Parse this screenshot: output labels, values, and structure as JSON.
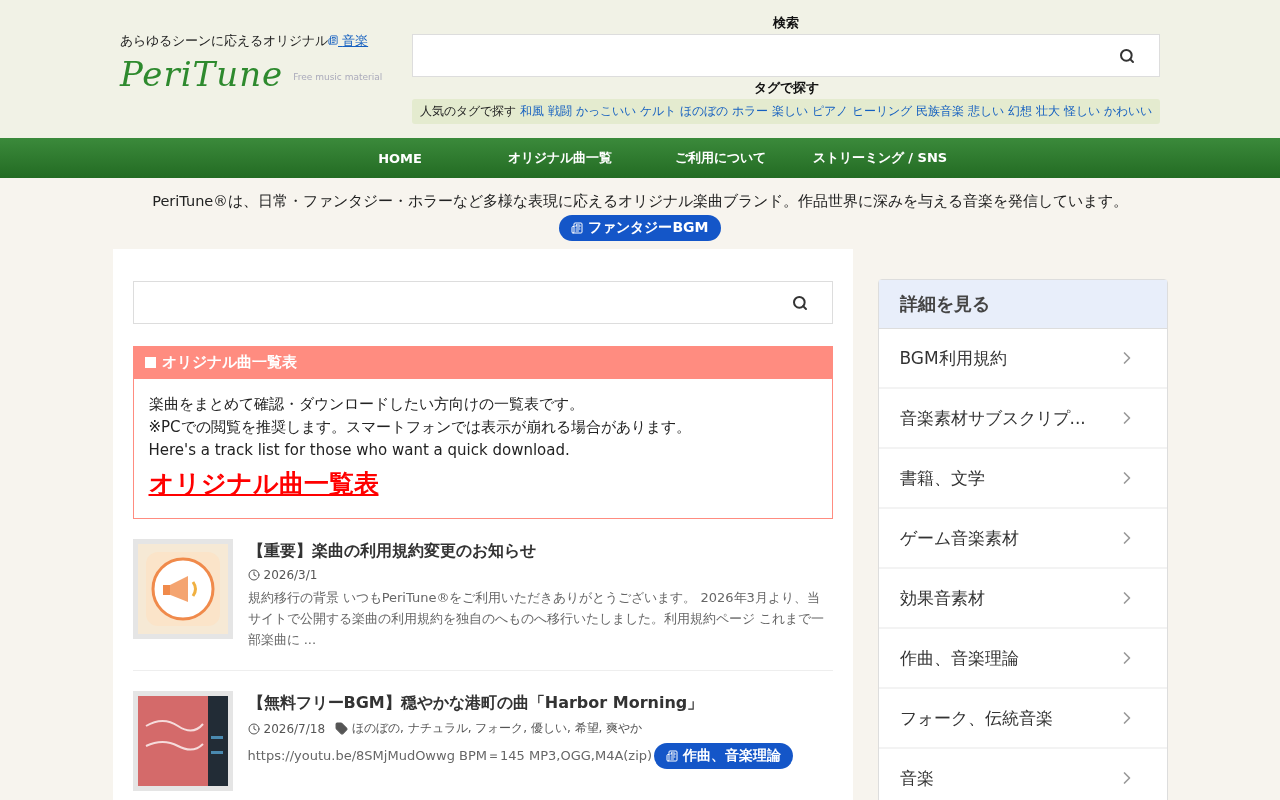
{
  "header": {
    "tagline": "あらゆるシーンに応えるオリジナル",
    "tagline_link": "音楽",
    "logo": "PeriTune",
    "logo_sub": "Free music material",
    "search_label": "検索",
    "tag_label": "タグで探す",
    "tag_intro": "人気のタグで探す",
    "tags": [
      "和風",
      "戦闘",
      "かっこいい",
      "ケルト",
      "ほのぼの",
      "ホラー",
      "楽しい",
      "ピアノ",
      "ヒーリング",
      "民族音楽",
      "悲しい",
      "幻想",
      "壮大",
      "怪しい",
      "かわいい"
    ]
  },
  "nav": [
    {
      "label": "HOME"
    },
    {
      "label": "オリジナル曲一覧"
    },
    {
      "label": "ご利用について"
    },
    {
      "label": "ストリーミング / SNS"
    }
  ],
  "intro": {
    "text": "PeriTune®は、日常・ファンタジー・ホラーなど多様な表現に応えるオリジナル楽曲ブランド。作品世界に深みを与える音楽を発信しています。",
    "badge": "ファンタジーBGM"
  },
  "notice": {
    "title": "オリジナル曲一覧表",
    "lines": [
      "楽曲をまとめて確認・ダウンロードしたい方向けの一覧表です。",
      "※PCでの閲覧を推奨します。スマートフォンでは表示が崩れる場合があります。",
      "Here's a track list for those who want a quick download."
    ],
    "link": "オリジナル曲一覧表"
  },
  "posts": [
    {
      "title": "【重要】楽曲の利用規約変更のお知らせ",
      "date": "2026/3/1",
      "excerpt": "規約移行の背景 いつもPeriTune®をご利用いただきありがとうございます。 2026年3月より、当サイトで公開する楽曲の利用規約を独自のへものへ移行いたしました。利用規約ページ これまで一部楽曲に ..."
    },
    {
      "title": "【無料フリーBGM】穏やかな港町の曲「Harbor Morning」",
      "date": "2026/7/18",
      "tags": "ほのぼの, ナチュラル, フォーク, 優しい, 希望, 爽やか",
      "excerpt": "https://youtu.be/8SMjMudOwwg BPM＝145 MP3,OGG,M4A(zip)",
      "category": "作曲、音楽理論"
    }
  ],
  "sidebar": {
    "title": "詳細を見る",
    "items": [
      "BGM利用規約",
      "音楽素材サブスクリプ...",
      "書籍、文学",
      "ゲーム音楽素材",
      "効果音素材",
      "作曲、音楽理論",
      "フォーク、伝統音楽",
      "音楽"
    ]
  }
}
